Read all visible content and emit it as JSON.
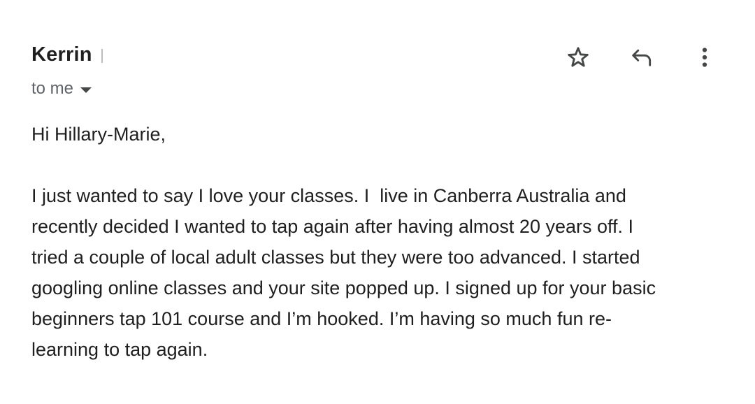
{
  "sender": {
    "name": "Kerrin"
  },
  "recipient": {
    "label": "to me"
  },
  "icons": {
    "star": "star-outline-icon",
    "reply": "reply-arrow-icon",
    "more": "vertical-dots-icon"
  },
  "message": {
    "greeting": "Hi Hillary-Marie,",
    "lines": [
      "I just wanted to say I love your classes. I  live in Canberra Australia and",
      "recently decided I wanted to tap again after having almost 20 years off. I",
      "tried a couple of local adult classes but they were too advanced. I started",
      "googling online classes and your site popped up. I signed up for your basic",
      "beginners tap 101 course and I’m hooked. I’m having so much fun re-",
      "learning to tap again."
    ]
  },
  "colors": {
    "text": "#1f1f1f",
    "secondary_text": "#5f6368",
    "icon": "#444746",
    "background": "#ffffff"
  }
}
